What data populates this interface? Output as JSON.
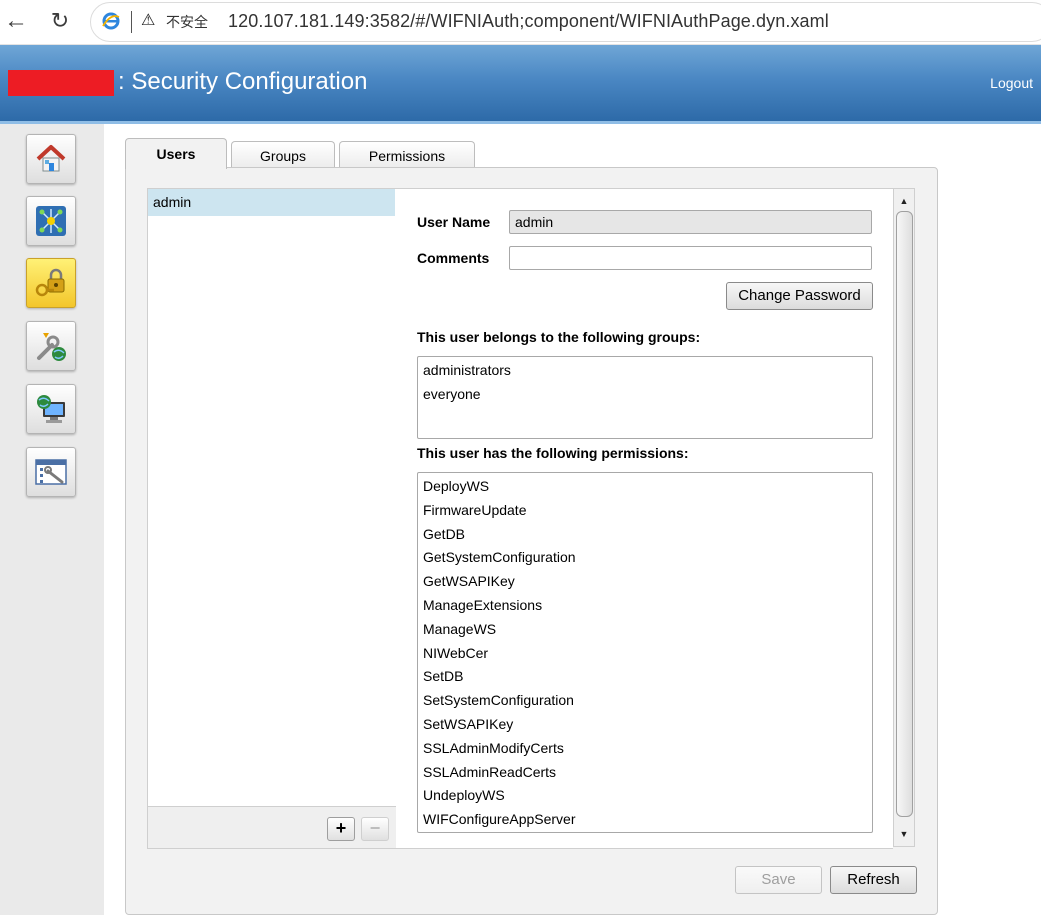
{
  "browser": {
    "security_label": "不安全",
    "url": "120.107.181.149:3582/#/WIFNIAuth;component/WIFNIAuthPage.dyn.xaml"
  },
  "header": {
    "title": ": Security Configuration",
    "logout_label": "Logout",
    "background_color": "#3d7ab8"
  },
  "sidebar": {
    "items": [
      {
        "icon": "home-icon"
      },
      {
        "icon": "network-icon"
      },
      {
        "icon": "security-lock-icon",
        "active": true
      },
      {
        "icon": "tools-globe-icon"
      },
      {
        "icon": "computer-globe-icon"
      },
      {
        "icon": "settings-window-icon"
      }
    ]
  },
  "tabs": [
    {
      "label": "Users",
      "active": true
    },
    {
      "label": "Groups"
    },
    {
      "label": "Permissions"
    }
  ],
  "users": {
    "items": [
      "admin"
    ],
    "selected": "admin",
    "add_label": "+",
    "remove_label": "−"
  },
  "details": {
    "username_label": "User Name",
    "username_value": "admin",
    "comments_label": "Comments",
    "comments_value": "",
    "change_password_label": "Change Password",
    "groups_heading": "This user belongs to the following groups:",
    "groups": [
      "administrators",
      "everyone"
    ],
    "permissions_heading": "This user has the following permissions:",
    "permissions": [
      "DeployWS",
      "FirmwareUpdate",
      "GetDB",
      "GetSystemConfiguration",
      "GetWSAPIKey",
      "ManageExtensions",
      "ManageWS",
      "NIWebCer",
      "SetDB",
      "SetSystemConfiguration",
      "SetWSAPIKey",
      "SSLAdminModifyCerts",
      "SSLAdminReadCerts",
      "UndeployWS",
      "WIFConfigureAppServer"
    ]
  },
  "footer": {
    "save_label": "Save",
    "refresh_label": "Refresh"
  }
}
